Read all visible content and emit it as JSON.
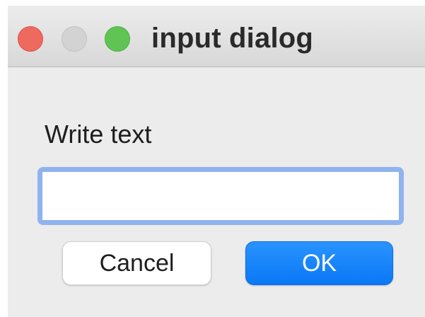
{
  "window": {
    "title": "input dialog",
    "controls": {
      "close_icon": "close-icon",
      "minimize_icon": "minimize-icon",
      "maximize_icon": "maximize-icon"
    }
  },
  "dialog": {
    "prompt": "Write text",
    "input_value": "",
    "cancel_label": "Cancel",
    "ok_label": "OK"
  },
  "colors": {
    "close": "#ee6a5e",
    "minimize": "#d3d3d3",
    "maximize": "#5fc454",
    "accent": "#0a78f5",
    "focus_ring": "#8fb3ee"
  }
}
